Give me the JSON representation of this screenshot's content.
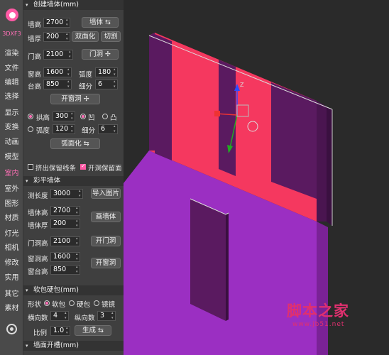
{
  "sidebar": {
    "brand": "3DXF3",
    "items": [
      "渲染",
      "文件",
      "编辑",
      "选择",
      "显示",
      "变换",
      "动画",
      "模型",
      "室内",
      "室外",
      "图形",
      "材质",
      "灯光",
      "相机",
      "修改",
      "实用",
      "其它",
      "素材"
    ],
    "active_index": 8
  },
  "wall_section": {
    "title": "创建墙体(mm)",
    "height_label": "墙高",
    "height_value": "2700",
    "wall_button": "墙体",
    "thick_label": "墙厚",
    "thick_value": "200",
    "double_button": "双面化",
    "cut_button": "切割",
    "door_label": "门高",
    "door_value": "2100",
    "door_button": "门洞",
    "winh_label": "窗高",
    "winh_value": "1600",
    "arc_label": "弧度",
    "arc_value": "180",
    "sill_label": "台高",
    "sill_value": "850",
    "seg_label": "细分",
    "seg_value": "6",
    "open_window_button": "开窗洞",
    "arch_label": "拱高",
    "arch_value": "300",
    "concave_label": "凹",
    "convex_label": "凸",
    "arc2_label": "弧度",
    "arc2_value": "120",
    "seg2_label": "细分",
    "seg2_value": "6",
    "arcify_button": "弧面化",
    "keep_border_label": "挤出保留线条",
    "keep_face_label": "开洞保留面"
  },
  "color_section": {
    "title": "彩平墙体",
    "measure_label": "测长度",
    "measure_value": "3000",
    "import_button": "导入图片",
    "height_label": "墙体高",
    "height_value": "2700",
    "thick_label": "墙体厚",
    "thick_value": "200",
    "draw_button": "画墙体",
    "door_label": "门洞高",
    "door_value": "2100",
    "door_button": "开门洞",
    "win_label": "窗洞高",
    "win_value": "1600",
    "sill_label": "窗台高",
    "sill_value": "850",
    "win_button": "开窗洞"
  },
  "soft_section": {
    "title": "软包硬包(mm)",
    "shape_label": "形状",
    "soft_label": "软包",
    "hard_label": "硬包",
    "mirror_label": "镜镜",
    "hcount_label": "横向数",
    "hcount_value": "4",
    "vcount_label": "纵向数",
    "vcount_value": "3",
    "ratio_label": "比例",
    "ratio_value": "1.0",
    "generate_button": "生成"
  },
  "groove_section": {
    "title": "墙面开槽(mm)"
  },
  "watermark": {
    "title": "脚本之家",
    "url": "www.jb51.net"
  },
  "gizmo": {
    "axis_label": "Z"
  },
  "colors": {
    "wall": "#f5385f",
    "floor": "#9b2fc2",
    "dark": "#5a1a60",
    "accent": "#ff5aa5"
  }
}
